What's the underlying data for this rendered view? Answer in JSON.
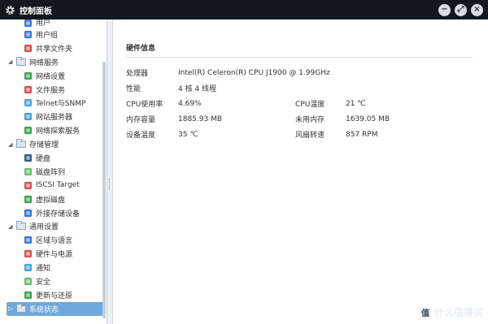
{
  "window": {
    "title": "控制面板"
  },
  "title_buttons": {
    "minimize": "−",
    "maximize": "⤢",
    "close": "×"
  },
  "sidebar": {
    "items": [
      {
        "kind": "child",
        "partial": true,
        "icon": "users-icon",
        "label": "用户"
      },
      {
        "kind": "child",
        "icon": "user-group-icon",
        "label": "用户组"
      },
      {
        "kind": "child",
        "icon": "shared-folder-icon",
        "label": "共享文件夹"
      },
      {
        "kind": "group",
        "icon": "folder-icon",
        "label": "网络服务"
      },
      {
        "kind": "child",
        "icon": "globe-icon",
        "label": "网络设置"
      },
      {
        "kind": "child",
        "icon": "file-service-icon",
        "label": "文件服务"
      },
      {
        "kind": "child",
        "icon": "terminal-icon",
        "label": "Telnet与SNMP"
      },
      {
        "kind": "child",
        "icon": "web-server-icon",
        "label": "网站服务器"
      },
      {
        "kind": "child",
        "icon": "network-discovery-icon",
        "label": "网络探索服务"
      },
      {
        "kind": "group",
        "icon": "folder-icon",
        "label": "存储管理"
      },
      {
        "kind": "child",
        "icon": "disk-icon",
        "label": "硬盘"
      },
      {
        "kind": "child",
        "icon": "raid-icon",
        "label": "磁盘阵列"
      },
      {
        "kind": "child",
        "icon": "iscsi-icon",
        "label": "ISCSI Target"
      },
      {
        "kind": "child",
        "icon": "virtual-disk-icon",
        "label": "虚拟磁盘"
      },
      {
        "kind": "child",
        "icon": "external-storage-icon",
        "label": "外接存储设备"
      },
      {
        "kind": "group",
        "icon": "folder-icon",
        "label": "通用设置"
      },
      {
        "kind": "child",
        "icon": "region-language-icon",
        "label": "区域与语言"
      },
      {
        "kind": "child",
        "icon": "hardware-power-icon",
        "label": "硬件与电源"
      },
      {
        "kind": "child",
        "icon": "notification-icon",
        "label": "通知"
      },
      {
        "kind": "child",
        "icon": "security-icon",
        "label": "安全"
      },
      {
        "kind": "child",
        "icon": "update-restore-icon",
        "label": "更新与还原"
      },
      {
        "kind": "group",
        "icon": "folder-icon",
        "label": "系统状态",
        "selected": true
      }
    ]
  },
  "hardware": {
    "section_title": "硬件信息",
    "rows": [
      {
        "label": "处理器",
        "value": "Intel(R) Celeron(R) CPU J1900 @ 1.99GHz",
        "label2": "",
        "value2": ""
      },
      {
        "label": "性能",
        "value": "4 核 4 线程",
        "label2": "",
        "value2": ""
      },
      {
        "label": "CPU使用率",
        "value": "4.69%",
        "label2": "CPU温度",
        "value2": "21 ℃"
      },
      {
        "label": "内存容量",
        "value": "1885.93 MB",
        "label2": "未用内存",
        "value2": "1639.05 MB"
      },
      {
        "label": "设备温度",
        "value": "35 ℃",
        "label2": "风扇转速",
        "value2": "857 RPM"
      }
    ]
  },
  "watermark": {
    "badge": "值",
    "text": "什么值得买"
  },
  "colors": {
    "selected": "#6fa8dc",
    "titlebar": "#111820"
  }
}
